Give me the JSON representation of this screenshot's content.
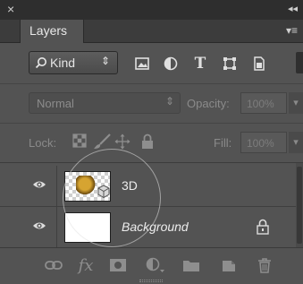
{
  "panel": {
    "tab_label": "Layers",
    "close_glyph": "×",
    "collapse_glyph": "◂◂",
    "menu_glyph": "▾≡"
  },
  "filter": {
    "kind_label": "Kind",
    "kind_chevron": "⇕",
    "icons": [
      "search-icon",
      "pixel-filter-icon",
      "adjustment-filter-icon",
      "type-filter-icon",
      "shape-filter-icon",
      "smart-object-filter-icon"
    ]
  },
  "blend": {
    "mode": "Normal",
    "chevron": "⇕",
    "opacity_label": "Opacity:",
    "opacity_value": "100%",
    "arrow": "▾"
  },
  "lock": {
    "label": "Lock:",
    "fill_label": "Fill:",
    "fill_value": "100%",
    "arrow": "▾"
  },
  "layers": [
    {
      "name": "3D",
      "visible": true,
      "thumbnail": "checkerboard-with-3d-object",
      "locked": false
    },
    {
      "name": "Background",
      "visible": true,
      "thumbnail": "white-fill",
      "locked": true
    }
  ],
  "bottom_bar": {
    "fx_label": "fx",
    "icons": [
      "link-layers-icon",
      "fx-icon",
      "add-mask-icon",
      "new-adjustment-icon",
      "new-group-folder-icon",
      "new-layer-icon",
      "trash-icon"
    ]
  },
  "colors": {
    "panel_bg": "#535353",
    "topbar_bg": "#2e2e2e",
    "tabstrip_bg": "#3c3c3c",
    "text": "#e6e6e6",
    "disabled_text": "#8a8a8a"
  }
}
